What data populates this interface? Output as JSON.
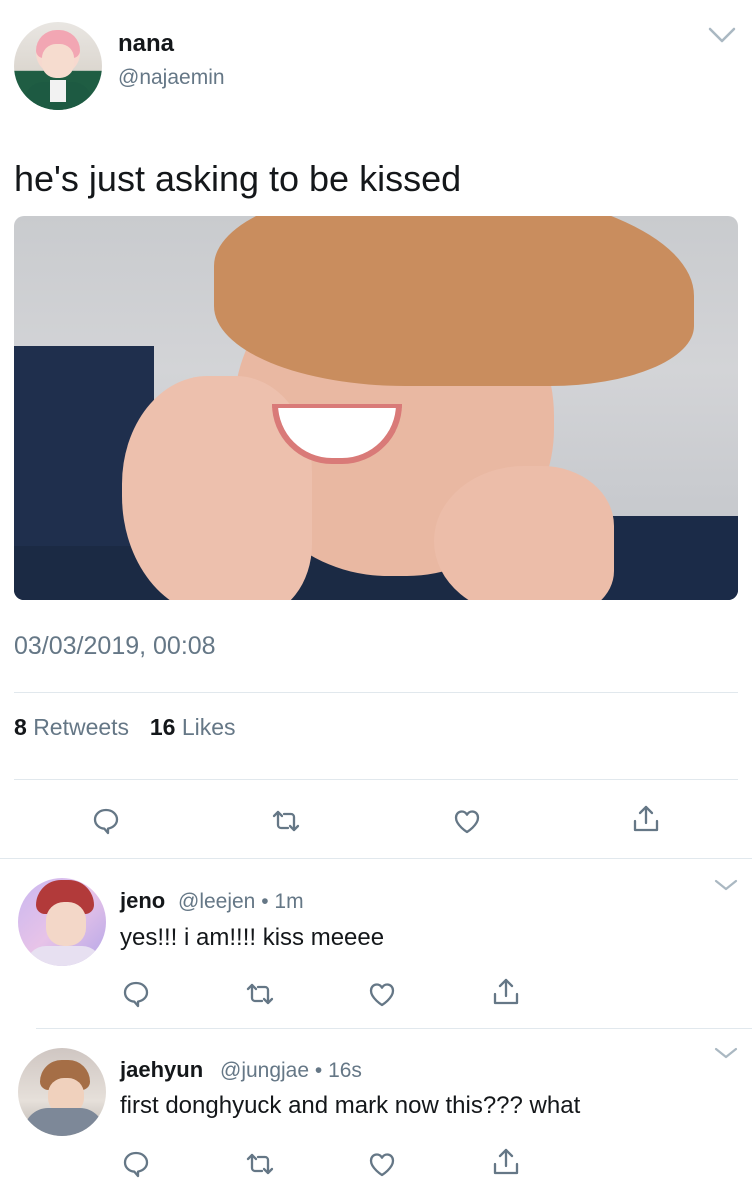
{
  "main_tweet": {
    "author_name": "nana",
    "author_handle": "@najaemin",
    "text": "he's just asking to be kissed",
    "timestamp": "03/03/2019, 00:08",
    "retweets_count": "8",
    "retweets_label": "Retweets",
    "likes_count": "16",
    "likes_label": "Likes"
  },
  "replies": [
    {
      "author_name": "jeno",
      "meta": "@leejen • 1m",
      "text": "yes!!! i am!!!! kiss meeee"
    },
    {
      "author_name": "jaehyun",
      "meta": "@jungjae • 16s",
      "text": "first donghyuck and mark now this??? what"
    }
  ],
  "icons": {
    "reply": "reply-icon",
    "retweet": "retweet-icon",
    "like": "heart-icon",
    "share": "share-icon",
    "more": "chevron-down-icon"
  },
  "colors": {
    "text_primary": "#14171a",
    "text_secondary": "#657786",
    "divider": "#e1e8ed",
    "icon": "#657786"
  }
}
